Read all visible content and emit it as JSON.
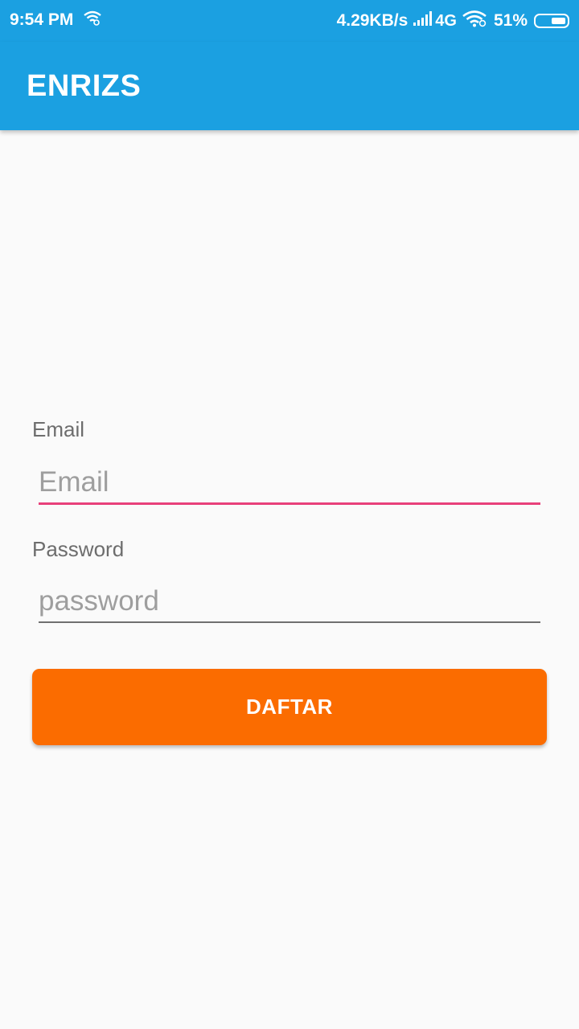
{
  "status_bar": {
    "time": "9:54 PM",
    "net_speed": "4.29KB/s",
    "network_type": "4G",
    "battery_percent": "51%",
    "battery_level": 0.51,
    "icons": [
      "wifi-hotspot-icon",
      "signal-bars-icon",
      "wifi-icon",
      "battery-icon"
    ]
  },
  "app_bar": {
    "title": "ENRIZS",
    "color": "#1ba0e1"
  },
  "form": {
    "email": {
      "label": "Email",
      "placeholder": "Email",
      "value": "",
      "focused": true
    },
    "password": {
      "label": "Password",
      "placeholder": "password",
      "value": ""
    },
    "submit_label": "DAFTAR"
  },
  "colors": {
    "primary": "#1ba0e1",
    "accent": "#e8407a",
    "button": "#fb6c00",
    "background": "#fafafa"
  }
}
